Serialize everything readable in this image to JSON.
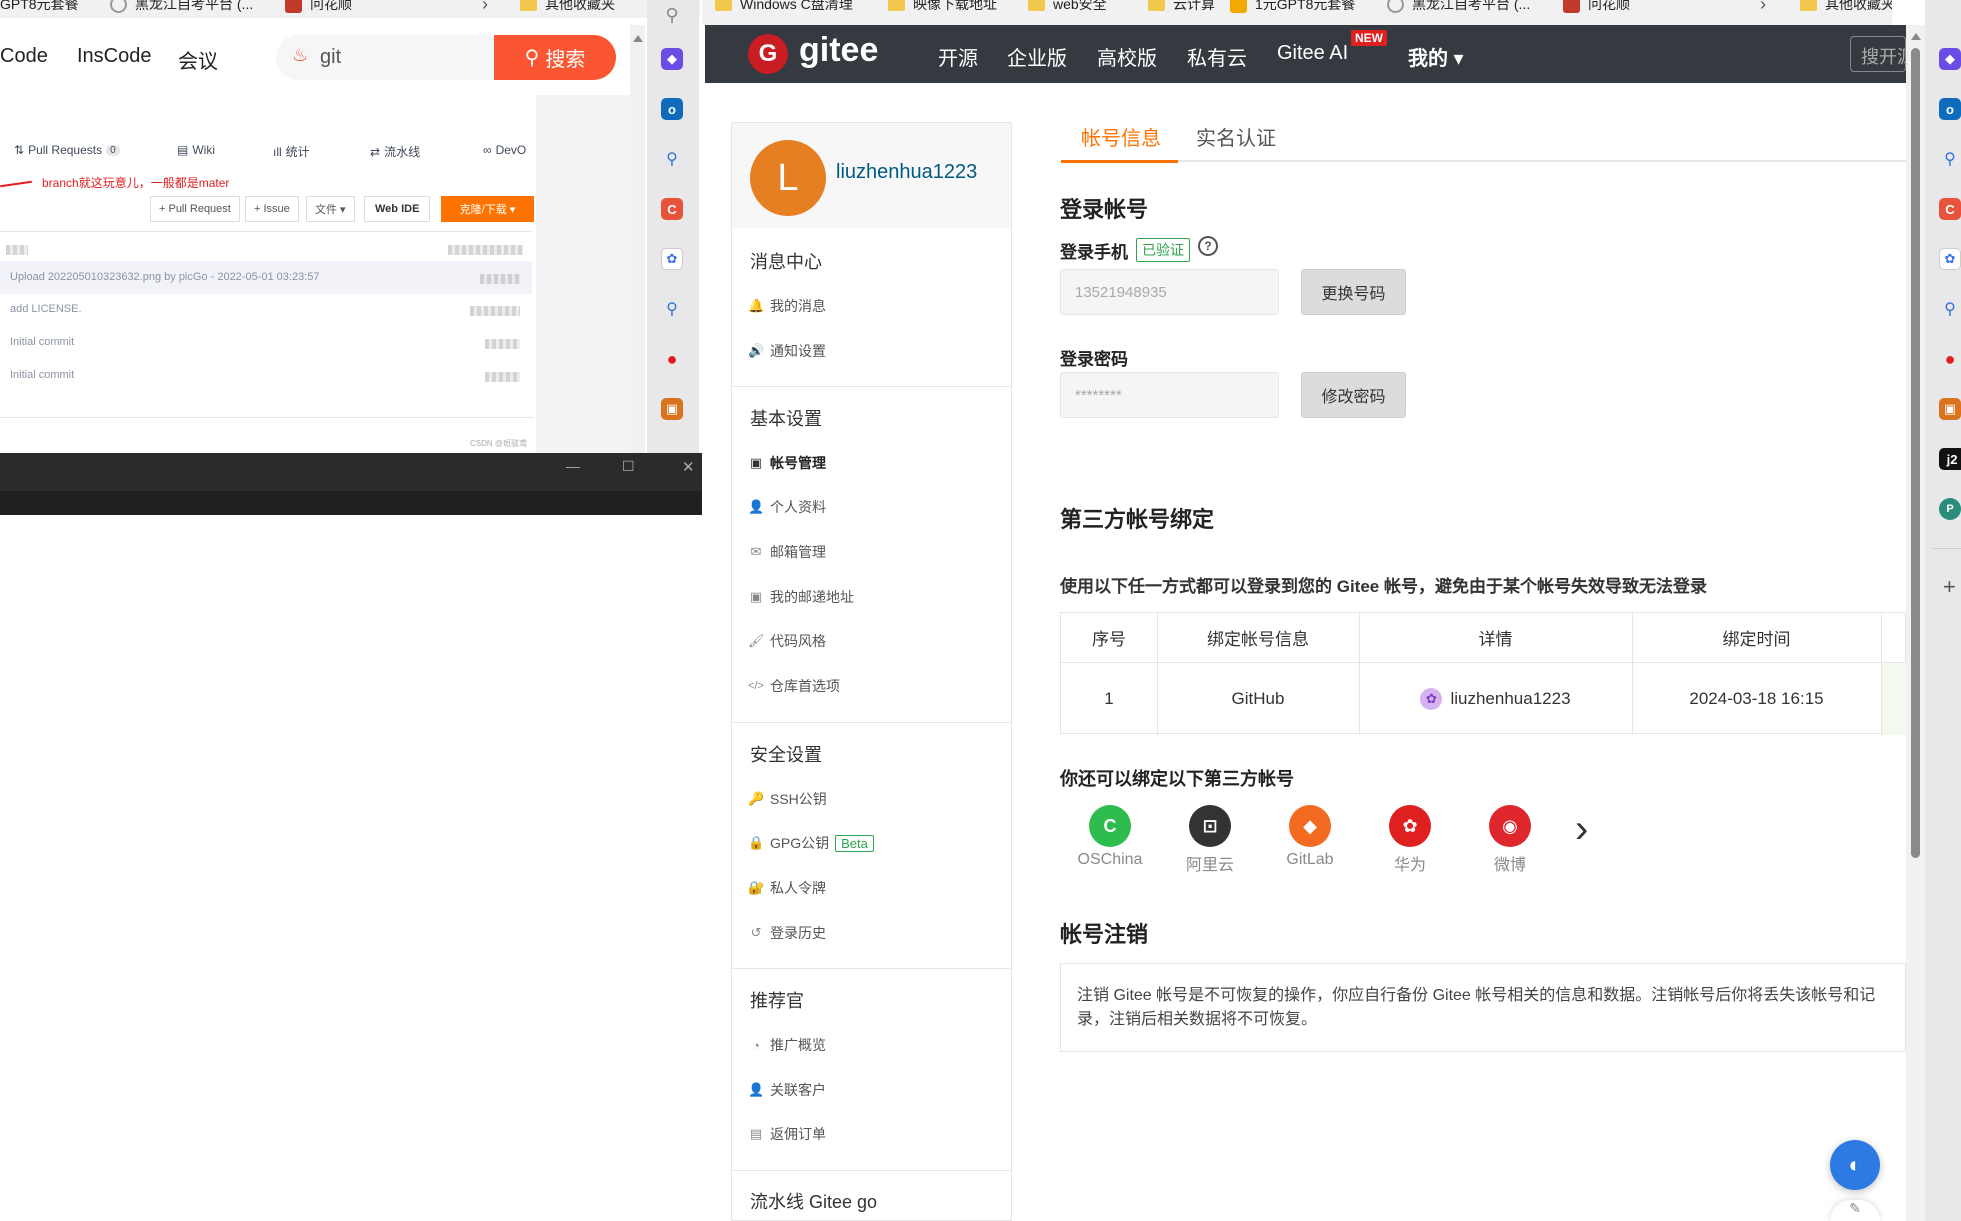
{
  "bookmarks": {
    "left": [
      "GPT8元套餐",
      "黑龙江自考平台 (...",
      "问花顺"
    ],
    "right": [
      "Windows C盘清理",
      "映像下载地址",
      "web安全",
      "云计算",
      "1元GPT8元套餐",
      "黑龙江自考平台 (...",
      "问花顺"
    ],
    "far_right": "其他收藏夹",
    "far_right2": "其他收藏夹"
  },
  "left_window": {
    "nav": [
      "Code",
      "InsCode",
      "会议"
    ],
    "search_value": "git",
    "search_button": "搜索",
    "repo_tabs": [
      {
        "icon": "⇅",
        "label": "Pull Requests",
        "badge": "0"
      },
      {
        "icon": "▤",
        "label": "Wiki"
      },
      {
        "icon": "ıll",
        "label": "统计"
      },
      {
        "icon": "⇄",
        "label": "流水线"
      },
      {
        "icon": "∞",
        "label": "DevO"
      }
    ],
    "annotation": "branch就这玩意儿，一般都是mater",
    "actions": {
      "pr": "+ Pull Request",
      "issue": "+ Issue",
      "file": "文件 ▾",
      "webide": "Web IDE",
      "clone": "克隆/下载 ▾"
    },
    "commits": [
      "Upload 202205010323632.png by picGo - 2022-05-01 03:23:57",
      "add LICENSE.",
      "Initial commit",
      "Initial commit"
    ],
    "footer": "CSDN @斑驳鸢"
  },
  "terminal": {
    "min": "—",
    "max": "☐",
    "close": "✕"
  },
  "gitee": {
    "logo_text": "gitee",
    "logo_letter": "G",
    "nav": [
      "开源",
      "企业版",
      "高校版",
      "私有云",
      "Gitee AI",
      "我的 ▾"
    ],
    "new_badge": "NEW",
    "search_placeholder": "搜开源"
  },
  "sidebar": {
    "avatar_letter": "L",
    "username": "liuzhenhua1223",
    "groups": [
      {
        "title": "消息中心",
        "items": [
          {
            "icon": "🔔",
            "label": "我的消息"
          },
          {
            "icon": "🔊",
            "label": "通知设置"
          }
        ]
      },
      {
        "title": "基本设置",
        "items": [
          {
            "icon": "▣",
            "label": "帐号管理"
          },
          {
            "icon": "👤",
            "label": "个人资料"
          },
          {
            "icon": "✉",
            "label": "邮箱管理"
          },
          {
            "icon": "▣",
            "label": "我的邮递地址"
          },
          {
            "icon": "🖌",
            "label": "代码风格"
          },
          {
            "icon": "</>",
            "label": "仓库首选项"
          }
        ]
      },
      {
        "title": "安全设置",
        "items": [
          {
            "icon": "🔑",
            "label": "SSH公钥"
          },
          {
            "icon": "🔒",
            "label": "GPG公钥",
            "badge": "Beta"
          },
          {
            "icon": "🔐",
            "label": "私人令牌"
          },
          {
            "icon": "↺",
            "label": "登录历史"
          }
        ]
      },
      {
        "title": "推荐官",
        "items": [
          {
            "icon": "◔",
            "label": "推广概览"
          },
          {
            "icon": "👤",
            "label": "关联客户"
          },
          {
            "icon": "▤",
            "label": "返佣订单"
          }
        ]
      },
      {
        "title": "流水线 Gitee go",
        "items": []
      }
    ]
  },
  "content": {
    "tabs": [
      "帐号信息",
      "实名认证"
    ],
    "login_title": "登录帐号",
    "phone_label": "登录手机",
    "verified": "已验证",
    "phone_value": "13521948935",
    "change_phone": "更换号码",
    "password_label": "登录密码",
    "password_value": "********",
    "change_password": "修改密码",
    "third_title": "第三方帐号绑定",
    "third_desc": "使用以下任一方式都可以登录到您的 Gitee 帐号，避免由于某个帐号失效导致无法登录",
    "table": {
      "headers": [
        "序号",
        "绑定帐号信息",
        "详情",
        "绑定时间"
      ],
      "rows": [
        [
          "1",
          "GitHub",
          "liuzhenhua1223",
          "2024-03-18 16:15"
        ]
      ]
    },
    "bind_more_title": "你还可以绑定以下第三方帐号",
    "providers": [
      {
        "name": "OSChina",
        "color": "#2ebc4f",
        "glyph": "C"
      },
      {
        "name": "阿里云",
        "color": "#333333",
        "glyph": "⊡"
      },
      {
        "name": "GitLab",
        "color": "#f36b21",
        "glyph": "◆"
      },
      {
        "name": "华为",
        "color": "#e02020",
        "glyph": "✿"
      },
      {
        "name": "微博",
        "color": "#e0262d",
        "glyph": "◉"
      }
    ],
    "cancel_title": "帐号注销",
    "cancel_text": "注销 Gitee 帐号是不可恢复的操作，你应自行备份 Gitee 帐号相关的信息和数据。注销帐号后你将丢失该帐号和记录，注销后相关数据将不可恢复。"
  },
  "right_strip": {
    "j2": "j2",
    "p": "P",
    "plus": "+"
  }
}
